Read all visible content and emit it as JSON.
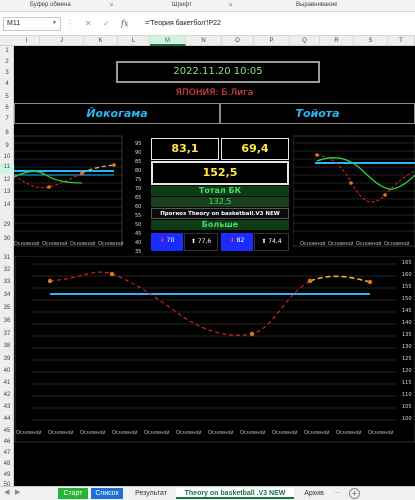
{
  "ribbon": {
    "groups": [
      "Буфер обмена",
      "Шрифт",
      "Выравнивание"
    ]
  },
  "formula_bar": {
    "name_box": "M11",
    "formula": "='Теория бакетбол'!P22"
  },
  "columns": [
    "I",
    "J",
    "K",
    "L",
    "M",
    "N",
    "O",
    "P",
    "Q",
    "R",
    "S",
    "T"
  ],
  "rows": [
    "1",
    "2",
    "3",
    "4",
    "5",
    "6",
    "7",
    "8",
    "9",
    "10",
    "11",
    "12",
    "13",
    "14",
    "29",
    "30",
    "31",
    "32",
    "33",
    "34",
    "35",
    "36",
    "37",
    "38",
    "39",
    "40",
    "41",
    "42",
    "43",
    "44",
    "45",
    "46",
    "47",
    "48",
    "49",
    "50",
    "51",
    "52"
  ],
  "dashboard": {
    "datetime": "2022.11.20 10:05",
    "league": "ЯПОНИЯ: Б.Лига",
    "team_home": "Йокогама",
    "team_away": "Тойота",
    "score_home": "83,1",
    "score_away": "69,4",
    "total_sum": "152,5",
    "total_label": "Тотал БК",
    "total_value": "132,5",
    "forecast_label": "Прогноз Theory on basketball.V3 NEW",
    "forecast_result": "Больше",
    "home_low": "70",
    "home_high": "77,6",
    "away_low": "82",
    "away_high": "74,4"
  },
  "mini_left": {
    "y_ticks": [
      "95",
      "90",
      "85",
      "80",
      "75",
      "70",
      "65",
      "60",
      "55",
      "50",
      "45",
      "40",
      "35"
    ],
    "x_ticks": [
      "Основной",
      "Основной",
      "Основной",
      "Основной"
    ]
  },
  "mini_right": {
    "x_ticks": [
      "Основной",
      "Основной",
      "Основной",
      "Основной"
    ]
  },
  "big_chart": {
    "y_ticks": [
      "165",
      "160",
      "155",
      "150",
      "145",
      "140",
      "135",
      "130",
      "125",
      "120",
      "115",
      "110",
      "105",
      "100"
    ],
    "x_ticks": [
      "Основной",
      "Основной",
      "Основной",
      "Основной",
      "Основной",
      "Основной",
      "Основной",
      "Основной",
      "Основной",
      "Основной",
      "Основной",
      "Основной"
    ]
  },
  "tabs": {
    "start": "Старт",
    "list": "Список",
    "result": "Результат",
    "theory": "Theory on basketball .V3 NEW",
    "archive": "Архив"
  },
  "colors": {
    "total_line": "#29b6f6",
    "red_dashed": "#e52222",
    "green_line": "#2ecc40",
    "yellow_dashed": "#f2b134",
    "marker": "#e8741a"
  }
}
